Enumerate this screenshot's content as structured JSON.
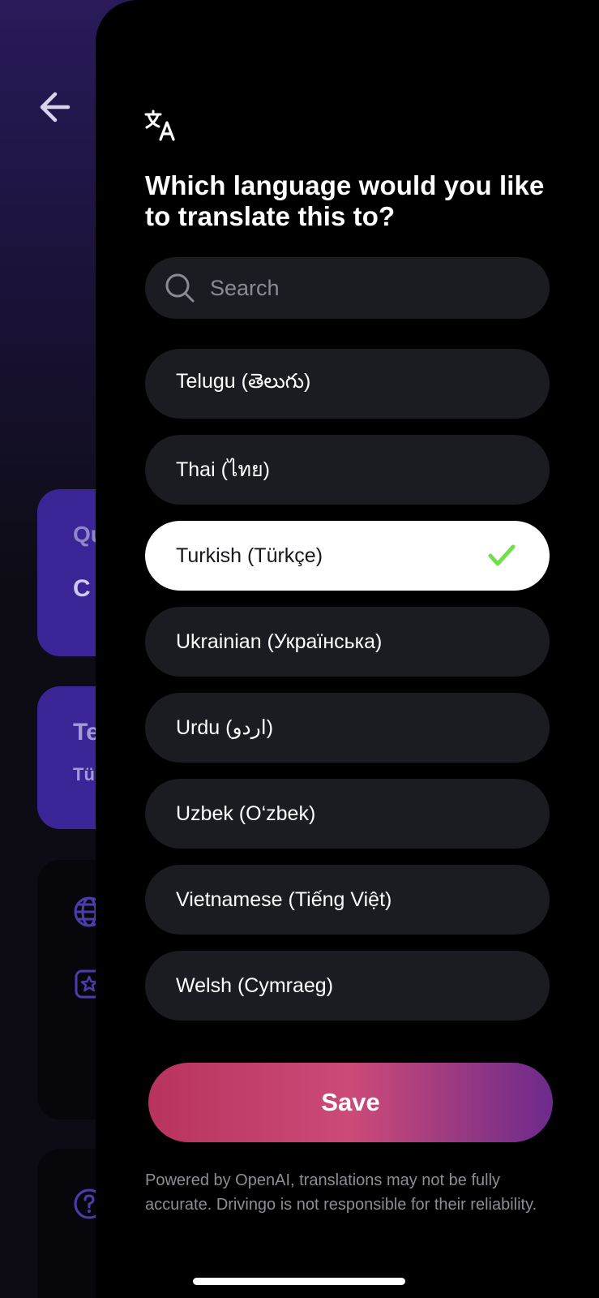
{
  "background": {
    "card1": {
      "line1": "Qu",
      "line2": "C"
    },
    "card2": {
      "line1": "Te",
      "line2": "Tü"
    }
  },
  "sheet": {
    "title": "Which language would you like to translate this to?",
    "search": {
      "placeholder": "Search",
      "value": ""
    },
    "languages": [
      {
        "label": "Telugu (తెలుగు)",
        "selected": false
      },
      {
        "label": "Thai (ไทย)",
        "selected": false
      },
      {
        "label": "Turkish (Türkçe)",
        "selected": true
      },
      {
        "label": "Ukrainian (Українська)",
        "selected": false
      },
      {
        "label": "Urdu (اردو)",
        "selected": false
      },
      {
        "label": "Uzbek (O‘zbek)",
        "selected": false
      },
      {
        "label": "Vietnamese (Tiếng Việt)",
        "selected": false
      },
      {
        "label": "Welsh (Cymraeg)",
        "selected": false
      }
    ],
    "save_label": "Save",
    "disclaimer": "Powered by OpenAI, translations may not be fully accurate. Drivingo is not responsible for their reliability."
  },
  "icons": {
    "back": "arrow-left-icon",
    "translate": "translate-icon",
    "search": "search-icon",
    "check": "checkmark-icon"
  },
  "colors": {
    "accent_check": "#6fe04a",
    "save_gradient_start": "#b8345e",
    "save_gradient_end": "#6d2a8c",
    "bg_card_purple": "#3b2596"
  }
}
